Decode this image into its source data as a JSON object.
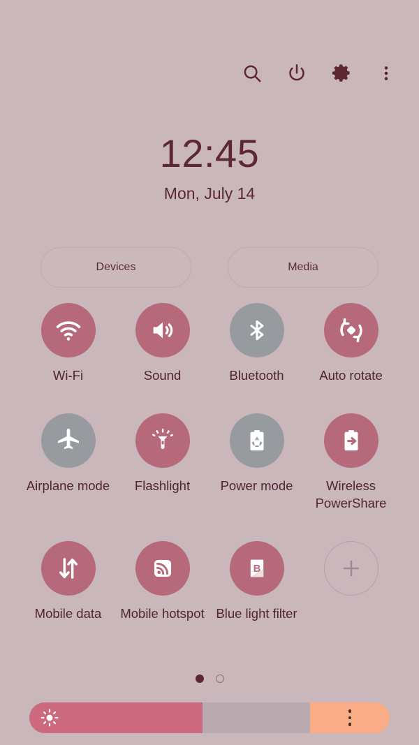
{
  "theme": {
    "background": "#cab7bb",
    "accent_on": "#b5697a",
    "inactive": "#979ba0",
    "text": "#4f2531",
    "slider_fill": "#cd697e",
    "slider_track": "#b9aab0",
    "slider_right": "#f9ac86"
  },
  "topbar": {
    "icons": [
      {
        "name": "search-icon",
        "label": "Search"
      },
      {
        "name": "power-icon",
        "label": "Power"
      },
      {
        "name": "settings-gear-icon",
        "label": "Settings"
      },
      {
        "name": "overflow-menu-icon",
        "label": "More options"
      }
    ]
  },
  "clock": {
    "time": "12:45",
    "date": "Mon, July 14"
  },
  "pills": [
    {
      "label": "Devices"
    },
    {
      "label": "Media"
    }
  ],
  "tiles": [
    {
      "label": "Wi-Fi",
      "icon": "wifi-icon",
      "state": "on"
    },
    {
      "label": "Sound",
      "icon": "sound-icon",
      "state": "on"
    },
    {
      "label": "Bluetooth",
      "icon": "bluetooth-icon",
      "state": "off"
    },
    {
      "label": "Auto rotate",
      "icon": "auto-rotate-icon",
      "state": "on"
    },
    {
      "label": "Airplane mode",
      "icon": "airplane-icon",
      "state": "off"
    },
    {
      "label": "Flashlight",
      "icon": "flashlight-icon",
      "state": "on"
    },
    {
      "label": "Power mode",
      "icon": "power-mode-icon",
      "state": "off"
    },
    {
      "label": "Wireless PowerShare",
      "icon": "wireless-powershare-icon",
      "state": "on"
    },
    {
      "label": "Mobile data",
      "icon": "mobile-data-icon",
      "state": "on"
    },
    {
      "label": "Mobile hotspot",
      "icon": "mobile-hotspot-icon",
      "state": "on"
    },
    {
      "label": "Blue light filter",
      "icon": "blue-light-filter-icon",
      "state": "on"
    },
    {
      "label": "",
      "icon": "add-icon",
      "state": "add"
    }
  ],
  "pagination": {
    "total": 2,
    "current": 1
  },
  "brightness": {
    "icon": "brightness-sun-icon",
    "value_percent": 48,
    "menu_icon": "slider-overflow-icon"
  }
}
